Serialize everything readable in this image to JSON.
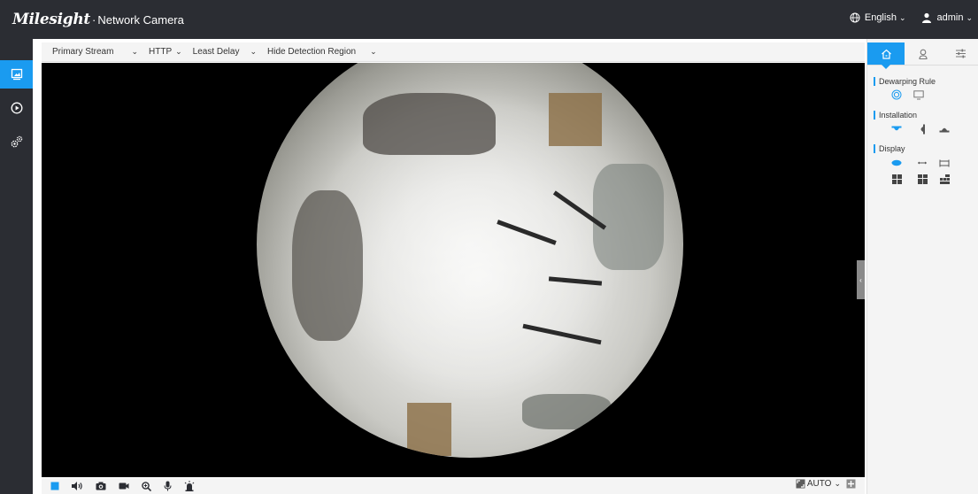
{
  "header": {
    "brand": "Milesight",
    "separator": "·",
    "product": "Network Camera",
    "language": "English",
    "user": "admin"
  },
  "leftnav": {
    "items": [
      {
        "name": "live-view",
        "icon": "monitor-icon",
        "active": true
      },
      {
        "name": "playback",
        "icon": "play-circle-icon",
        "active": false
      },
      {
        "name": "settings",
        "icon": "gears-icon",
        "active": false
      }
    ]
  },
  "toolbar": {
    "stream": "Primary Stream",
    "protocol": "HTTP",
    "delay": "Least Delay",
    "detection": "Hide Detection Region"
  },
  "bottombar": {
    "icons": [
      "stop-icon",
      "volume-icon",
      "snapshot-icon",
      "record-icon",
      "zoom-icon",
      "microphone-icon",
      "alarm-icon"
    ],
    "zoom_mode": "AUTO"
  },
  "rpanel": {
    "tabs": [
      {
        "icon": "home-icon",
        "active": true
      },
      {
        "icon": "ptz-person-icon",
        "active": false
      },
      {
        "icon": "sliders-icon",
        "active": false
      }
    ],
    "dewarping_title": "Dewarping Rule",
    "installation_title": "Installation",
    "display_title": "Display"
  },
  "colors": {
    "accent": "#1a9bf0",
    "header_bg": "#2b2d33",
    "panel_bg": "#f4f4f4"
  }
}
